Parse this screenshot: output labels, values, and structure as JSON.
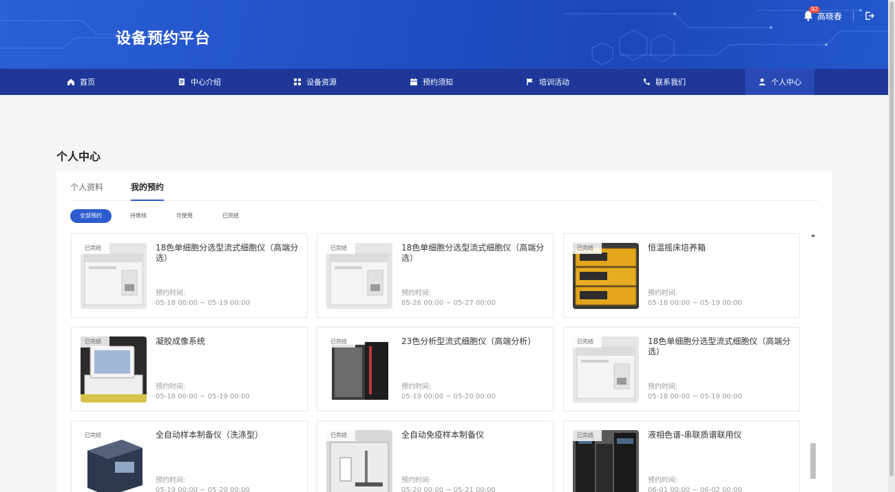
{
  "header": {
    "title": "设备预约平台",
    "notification_count": "92",
    "user_name": "高晓春"
  },
  "nav": {
    "items": [
      {
        "label": "首页",
        "icon": "home-icon"
      },
      {
        "label": "中心介绍",
        "icon": "document-icon"
      },
      {
        "label": "设备资源",
        "icon": "grid-icon"
      },
      {
        "label": "预约须知",
        "icon": "calendar-icon"
      },
      {
        "label": "培训活动",
        "icon": "flag-icon"
      },
      {
        "label": "联系我们",
        "icon": "phone-icon"
      },
      {
        "label": "个人中心",
        "icon": "user-icon"
      }
    ],
    "active_index": 6
  },
  "page": {
    "section_title": "个人中心",
    "tabs": [
      {
        "label": "个人资料",
        "active": false
      },
      {
        "label": "我的预约",
        "active": true
      }
    ],
    "filters": [
      {
        "label": "全部预约",
        "active": true
      },
      {
        "label": "待审核",
        "active": false
      },
      {
        "label": "可使用",
        "active": false
      },
      {
        "label": "已完结",
        "active": false
      }
    ]
  },
  "reservations": [
    {
      "status": "已完结",
      "title": "18色单细胞分选型流式细胞仪（高端分选）",
      "time_label": "预约时间:",
      "time_range": "05-18 00:00 ~ 05-19 00:00",
      "image": "flow-cytometer"
    },
    {
      "status": "已完结",
      "title": "18色单细胞分选型流式细胞仪（高端分选）",
      "time_label": "预约时间:",
      "time_range": "05-26 00:00 ~ 05-27 00:00",
      "image": "flow-cytometer"
    },
    {
      "status": "已完结",
      "title": "恒温摇床培养箱",
      "time_label": "预约时间:",
      "time_range": "05-18 00:00 ~ 05-19 00:00",
      "image": "shaker-incubator"
    },
    {
      "status": "已完结",
      "title": "凝胶成像系统",
      "time_label": "预约时间:",
      "time_range": "05-18 00:00 ~ 05-19 00:00",
      "image": "gel-imager"
    },
    {
      "status": "已完结",
      "title": "23色分析型流式细胞仪（高端分析）",
      "time_label": "预约时间:",
      "time_range": "05-19 00:00 ~ 05-20 00:00",
      "image": "analyzer-cytometer"
    },
    {
      "status": "已完结",
      "title": "18色单细胞分选型流式细胞仪（高端分选）",
      "time_label": "预约时间:",
      "time_range": "05-18 00:00 ~ 05-19 00:00",
      "image": "flow-cytometer"
    },
    {
      "status": "已完结",
      "title": "全自动样本制备仪（洗涤型）",
      "time_label": "预约时间:",
      "time_range": "05-19 00:00 ~ 05-20 00:00",
      "image": "sample-prep"
    },
    {
      "status": "已完结",
      "title": "全自动免疫样本制备仪",
      "time_label": "预约时间:",
      "time_range": "05-20 00:00 ~ 05-21 00:00",
      "image": "immune-prep"
    },
    {
      "status": "已完结",
      "title": "液相色谱-串联质谱联用仪",
      "time_label": "预约时间:",
      "time_range": "06-01 00:00 ~ 06-02 00:00",
      "image": "lc-ms"
    }
  ],
  "colors": {
    "header_blue": "#1f4fc4",
    "nav_blue": "#1e3799",
    "accent": "#2d5ccf",
    "badge_red": "#f0483e"
  }
}
